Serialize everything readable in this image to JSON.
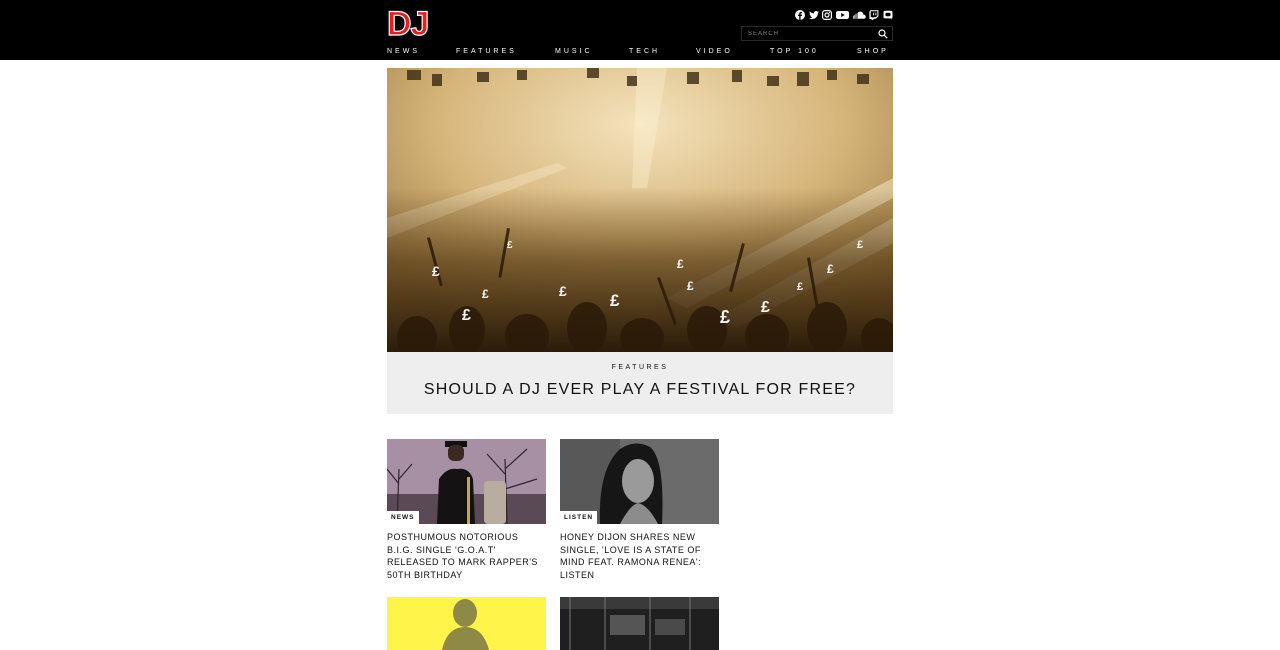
{
  "header": {
    "logo_text": "DJ",
    "social_icons": [
      "facebook-icon",
      "twitter-icon",
      "instagram-icon",
      "youtube-icon",
      "soundcloud-icon",
      "twitch-icon",
      "discord-icon"
    ],
    "search": {
      "placeholder": "SEARCH",
      "icon": "search-icon"
    },
    "nav": [
      "NEWS",
      "FEATURES",
      "MUSIC",
      "TECH",
      "VIDEO",
      "TOP 100",
      "SHOP"
    ]
  },
  "hero": {
    "category": "FEATURES",
    "title": "SHOULD A DJ EVER PLAY A FESTIVAL FOR FREE?"
  },
  "cards": [
    {
      "tag": "NEWS",
      "headline": "POSTHUMOUS NOTORIOUS B.I.G. SINGLE 'G.O.A.T' RELEASED TO MARK RAPPER'S 50TH BIRTHDAY"
    },
    {
      "tag": "LISTEN",
      "headline": "HONEY DIJON SHARES NEW SINGLE, 'LOVE IS A STATE OF MIND FEAT. RAMONA RENEA': LISTEN"
    }
  ],
  "colors": {
    "header_bg": "#000000",
    "logo_red": "#e51e25",
    "caption_bg": "#eeeeee",
    "hero_tint": "#c9a86a",
    "yellow_thumb": "#fff44a"
  }
}
